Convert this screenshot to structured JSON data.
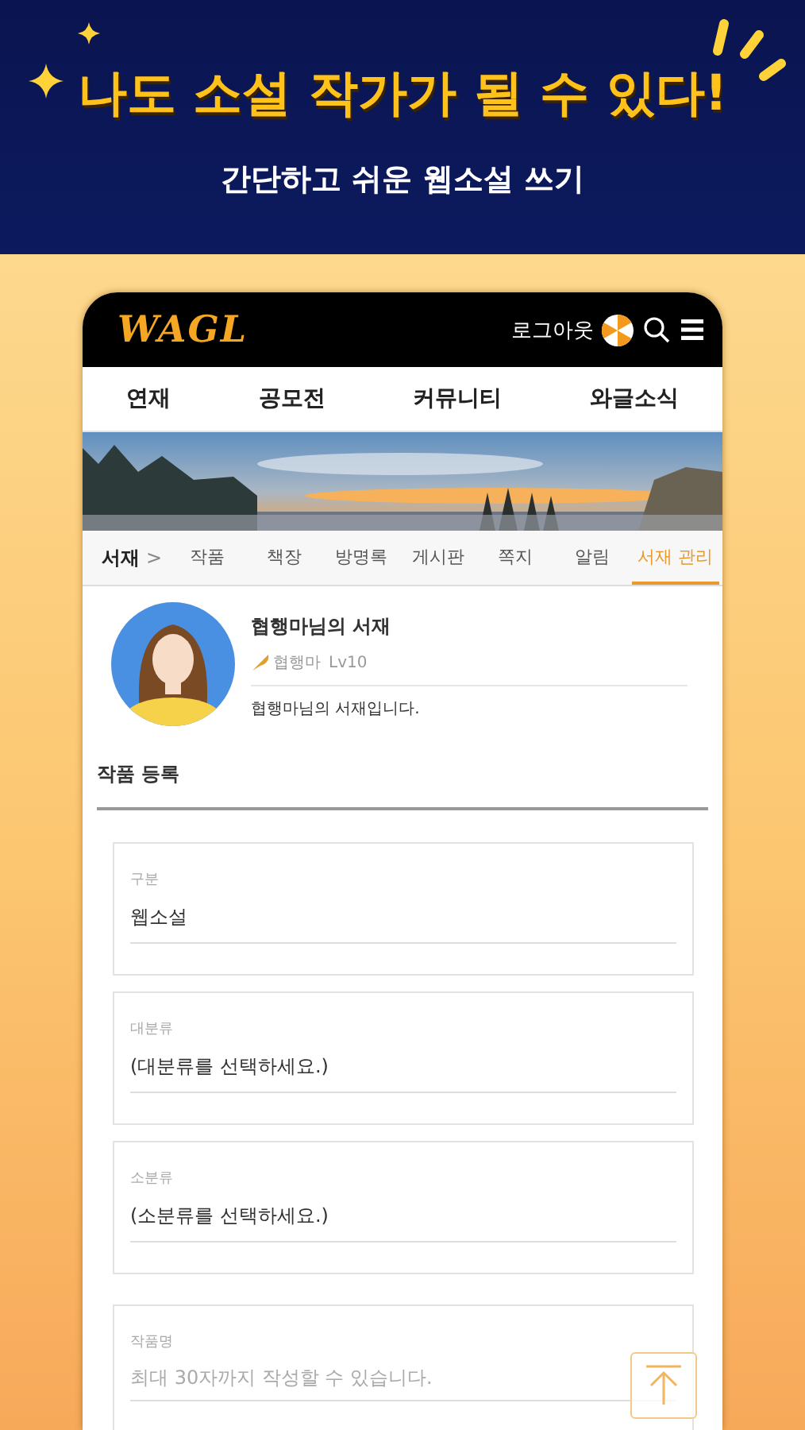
{
  "promo": {
    "headline": "나도 소설 작가가 될 수 있다!",
    "subtitle": "간단하고 쉬운 웹소설 쓰기"
  },
  "header": {
    "logo": "WAGL",
    "logout": "로그아웃"
  },
  "menu": [
    {
      "label": "연재"
    },
    {
      "label": "공모전"
    },
    {
      "label": "커뮤니티"
    },
    {
      "label": "와글소식"
    }
  ],
  "library_tabs": {
    "title": "서재",
    "separator": ">",
    "tabs": [
      {
        "label": "작품",
        "selected": false
      },
      {
        "label": "책장",
        "selected": false
      },
      {
        "label": "방명록",
        "selected": false
      },
      {
        "label": "게시판",
        "selected": false
      },
      {
        "label": "쪽지",
        "selected": false
      },
      {
        "label": "알림",
        "selected": false
      },
      {
        "label": "서재 관리",
        "selected": true
      }
    ]
  },
  "profile": {
    "name": "협행마님의 서재",
    "author": "협행마",
    "level": "Lv10",
    "intro": "협행마님의 서재입니다."
  },
  "section_title": "작품 등록",
  "fields": [
    {
      "label": "구분",
      "kind": "select",
      "value": "웹소설"
    },
    {
      "label": "대분류",
      "kind": "select",
      "value": "(대분류를 선택하세요.)"
    },
    {
      "label": "소분류",
      "kind": "select",
      "value": "(소분류를 선택하세요.)"
    },
    {
      "label": "작품명",
      "kind": "text",
      "placeholder": "최대 30자까지 작성할 수 있습니다."
    }
  ]
}
